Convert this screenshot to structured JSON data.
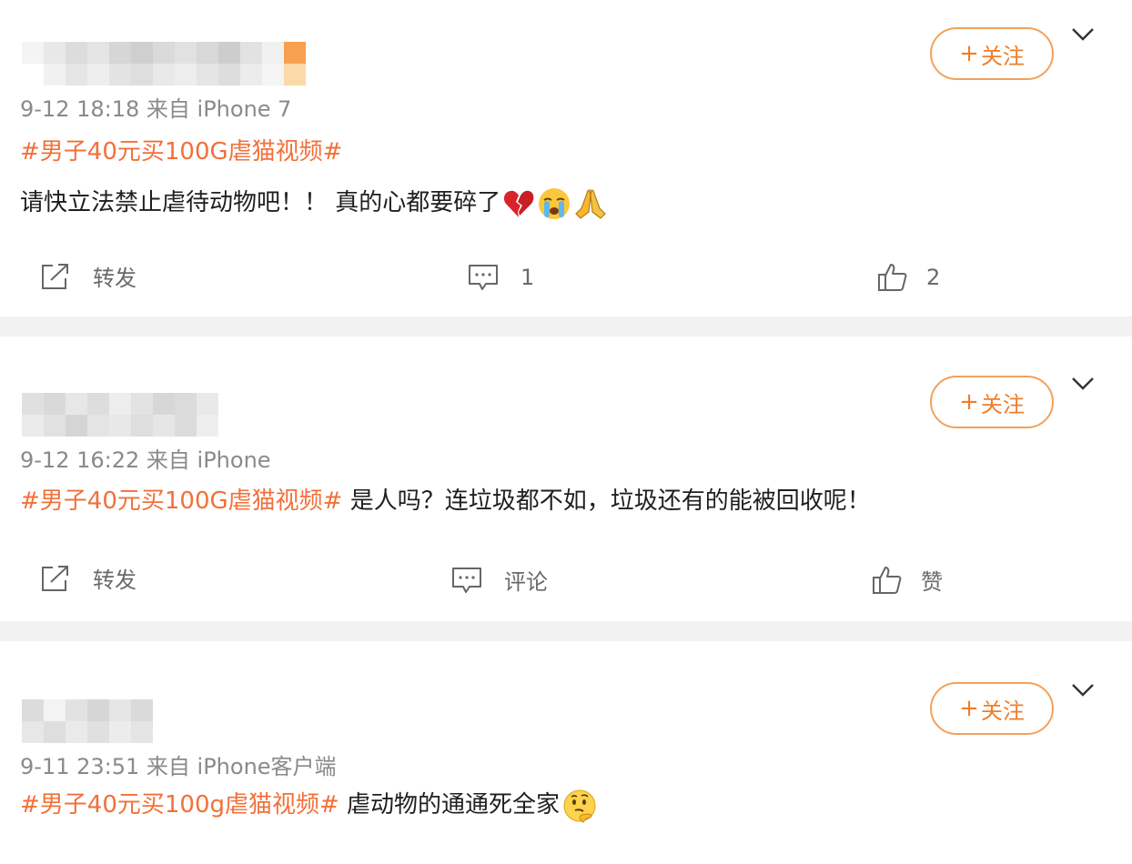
{
  "posts": [
    {
      "timestamp": "9-12 18:18",
      "source": "来自 iPhone 7",
      "follow_label": "关注",
      "hashtag": "#男子40元买100G虐猫视频#",
      "text": "请快立法禁止虐待动物吧！！ 真的心都要碎了",
      "emojis": [
        "broken-heart-icon",
        "crying-face-icon",
        "folded-hands-icon"
      ],
      "actions": {
        "repost": "转发",
        "comment": "1",
        "like": "2"
      }
    },
    {
      "timestamp": "9-12 16:22",
      "source": "来自 iPhone",
      "follow_label": "关注",
      "hashtag": "#男子40元买100G虐猫视频#",
      "text": " 是人吗？连垃圾都不如，垃圾还有的能被回收呢！",
      "actions": {
        "repost": "转发",
        "comment": "评论",
        "like": "赞"
      }
    },
    {
      "timestamp": "9-11 23:51",
      "source": "来自 iPhone客户端",
      "follow_label": "关注",
      "hashtag": "#男子40元买100g虐猫视频#",
      "text": " 虐动物的通通死全家",
      "emojis": [
        "thinking-face-icon"
      ]
    }
  ],
  "colors": {
    "accent": "#f2703a",
    "follow_border": "#f2a15c",
    "meta_text": "#8a8a8a",
    "separator": "#f2f2f2"
  }
}
